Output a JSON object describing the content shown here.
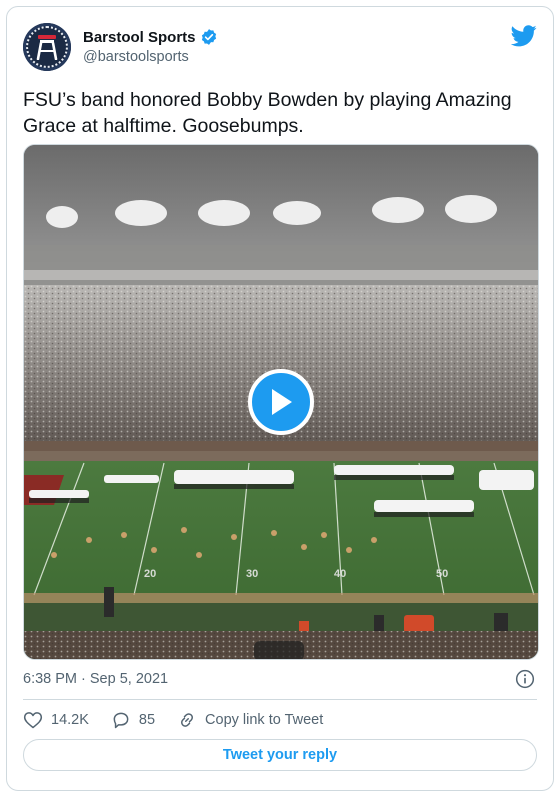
{
  "author": {
    "display_name": "Barstool Sports",
    "handle": "@barstoolsports",
    "verified_icon": "verified-badge-icon",
    "avatar_icon": "barstool-logo-icon"
  },
  "brand_icon": "twitter-bird-icon",
  "tweet": {
    "text": "FSU’s band honored Bobby Bowden by playing Amazing Grace at halftime. Goosebumps."
  },
  "media": {
    "type": "video",
    "play_icon": "play-icon",
    "field_yard_numbers": [
      "20",
      "30",
      "40",
      "50"
    ]
  },
  "meta": {
    "timestamp": "6:38 PM · Sep 5, 2021",
    "info_icon": "info-icon"
  },
  "actions": {
    "likes": "14.2K",
    "replies": "85",
    "copy_link_label": "Copy link to Tweet"
  },
  "reply_button_label": "Tweet your reply",
  "colors": {
    "accent": "#1d9bf0",
    "text_primary": "#0f1419",
    "text_secondary": "#536471",
    "border": "#cfd9de"
  }
}
